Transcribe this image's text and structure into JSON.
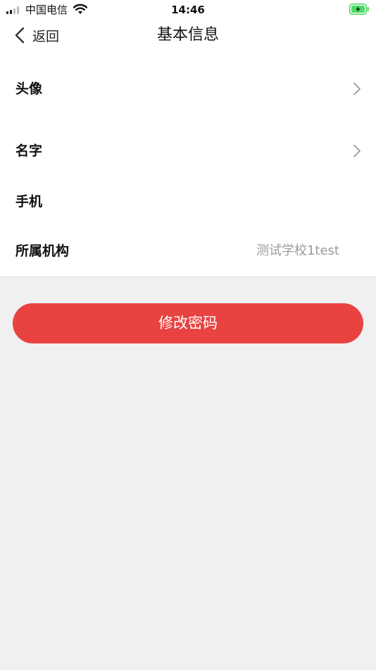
{
  "status_bar": {
    "carrier": "中国电信",
    "time": "14:46"
  },
  "nav": {
    "back_label": "返回",
    "title": "基本信息"
  },
  "rows": [
    {
      "label": "头像",
      "value": ""
    },
    {
      "label": "名字",
      "value": ""
    },
    {
      "label": "手机",
      "value": ""
    },
    {
      "label": "所属机构",
      "value": "测试学校1test"
    }
  ],
  "change_password_label": "修改密码",
  "colors": {
    "accent": "#e84341",
    "battery": "#4cd964",
    "background": "#f0f0f0"
  },
  "icons": {
    "back": "chevron-left-icon",
    "row_arrow": "chevron-right-icon",
    "wifi": "wifi-icon",
    "battery": "battery-charging-icon",
    "signal": "signal-icon"
  }
}
